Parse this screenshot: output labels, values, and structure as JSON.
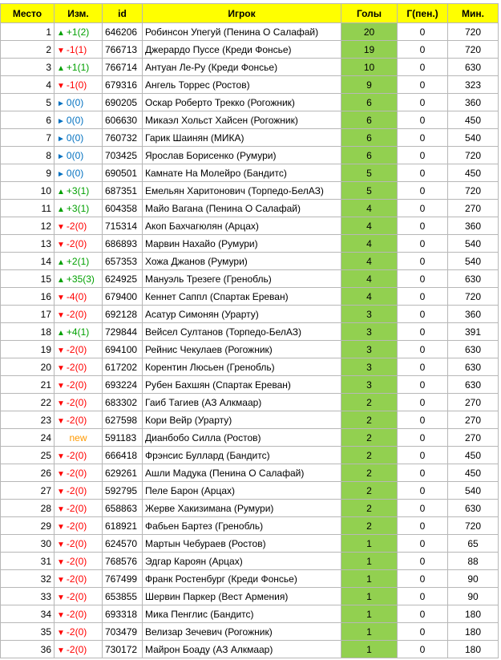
{
  "headers": [
    "Место",
    "Изм.",
    "id",
    "Игрок",
    "Голы",
    "Г(пен.)",
    "Мин."
  ],
  "colors": {
    "header_bg": "#ffff00",
    "goals_bg": "#92d050",
    "up": "#00a000",
    "down": "#ff0000",
    "same": "#0070c0",
    "new": "#ff9900"
  },
  "rows": [
    {
      "place": "1",
      "dir": "up",
      "change": "+1(2)",
      "id": "646206",
      "player": "Робинсон Упегуй (Пенина О Салафай)",
      "goals": "20",
      "pen": "0",
      "mins": "720"
    },
    {
      "place": "2",
      "dir": "down",
      "change": "-1(1)",
      "id": "766713",
      "player": "Джерардо Пуссе (Креди Фонсье)",
      "goals": "19",
      "pen": "0",
      "mins": "720"
    },
    {
      "place": "3",
      "dir": "up",
      "change": "+1(1)",
      "id": "766714",
      "player": "Антуан Ле-Ру (Креди Фонсье)",
      "goals": "10",
      "pen": "0",
      "mins": "630"
    },
    {
      "place": "4",
      "dir": "down",
      "change": "-1(0)",
      "id": "679316",
      "player": "Ангель Торрес (Ростов)",
      "goals": "9",
      "pen": "0",
      "mins": "323"
    },
    {
      "place": "5",
      "dir": "same",
      "change": "0(0)",
      "id": "690205",
      "player": "Оскар Роберто Трекко (Рогожник)",
      "goals": "6",
      "pen": "0",
      "mins": "360"
    },
    {
      "place": "6",
      "dir": "same",
      "change": "0(0)",
      "id": "606630",
      "player": "Микаэл Хольст Хайсен (Рогожник)",
      "goals": "6",
      "pen": "0",
      "mins": "450"
    },
    {
      "place": "7",
      "dir": "same",
      "change": "0(0)",
      "id": "760732",
      "player": "Гарик Шаинян (МИКА)",
      "goals": "6",
      "pen": "0",
      "mins": "540"
    },
    {
      "place": "8",
      "dir": "same",
      "change": "0(0)",
      "id": "703425",
      "player": "Ярослав Борисенко (Румури)",
      "goals": "6",
      "pen": "0",
      "mins": "720"
    },
    {
      "place": "9",
      "dir": "same",
      "change": "0(0)",
      "id": "690501",
      "player": "Камнате На Молейро (Бандитс)",
      "goals": "5",
      "pen": "0",
      "mins": "450"
    },
    {
      "place": "10",
      "dir": "up",
      "change": "+3(1)",
      "id": "687351",
      "player": "Емельян Харитонович (Торпедо-БелАЗ)",
      "goals": "5",
      "pen": "0",
      "mins": "720"
    },
    {
      "place": "11",
      "dir": "up",
      "change": "+3(1)",
      "id": "604358",
      "player": "Майо Вагана (Пенина О Салафай)",
      "goals": "4",
      "pen": "0",
      "mins": "270"
    },
    {
      "place": "12",
      "dir": "down",
      "change": "-2(0)",
      "id": "715314",
      "player": "Акоп Бахчагюлян (Арцах)",
      "goals": "4",
      "pen": "0",
      "mins": "360"
    },
    {
      "place": "13",
      "dir": "down",
      "change": "-2(0)",
      "id": "686893",
      "player": "Марвин Нахайо (Румури)",
      "goals": "4",
      "pen": "0",
      "mins": "540"
    },
    {
      "place": "14",
      "dir": "up",
      "change": "+2(1)",
      "id": "657353",
      "player": "Хожа Джанов (Румури)",
      "goals": "4",
      "pen": "0",
      "mins": "540"
    },
    {
      "place": "15",
      "dir": "up",
      "change": "+35(3)",
      "id": "624925",
      "player": "Мануэль Трезеге (Гренобль)",
      "goals": "4",
      "pen": "0",
      "mins": "630"
    },
    {
      "place": "16",
      "dir": "down",
      "change": "-4(0)",
      "id": "679400",
      "player": "Кеннет Саппл (Спартак Ереван)",
      "goals": "4",
      "pen": "0",
      "mins": "720"
    },
    {
      "place": "17",
      "dir": "down",
      "change": "-2(0)",
      "id": "692128",
      "player": "Асатур Симонян (Урарту)",
      "goals": "3",
      "pen": "0",
      "mins": "360"
    },
    {
      "place": "18",
      "dir": "up",
      "change": "+4(1)",
      "id": "729844",
      "player": "Вейсел Султанов (Торпедо-БелАЗ)",
      "goals": "3",
      "pen": "0",
      "mins": "391"
    },
    {
      "place": "19",
      "dir": "down",
      "change": "-2(0)",
      "id": "694100",
      "player": "Рейнис Чекулаев (Рогожник)",
      "goals": "3",
      "pen": "0",
      "mins": "630"
    },
    {
      "place": "20",
      "dir": "down",
      "change": "-2(0)",
      "id": "617202",
      "player": "Корентин Люсьен (Гренобль)",
      "goals": "3",
      "pen": "0",
      "mins": "630"
    },
    {
      "place": "21",
      "dir": "down",
      "change": "-2(0)",
      "id": "693224",
      "player": "Рубен Бахшян (Спартак Ереван)",
      "goals": "3",
      "pen": "0",
      "mins": "630"
    },
    {
      "place": "22",
      "dir": "down",
      "change": "-2(0)",
      "id": "683302",
      "player": "Гаиб Тагиев (АЗ Алкмаар)",
      "goals": "2",
      "pen": "0",
      "mins": "270"
    },
    {
      "place": "23",
      "dir": "down",
      "change": "-2(0)",
      "id": "627598",
      "player": "Кори Вейр (Урарту)",
      "goals": "2",
      "pen": "0",
      "mins": "270"
    },
    {
      "place": "24",
      "dir": "new",
      "change": "new",
      "id": "591183",
      "player": "Дианбобо Силла (Ростов)",
      "goals": "2",
      "pen": "0",
      "mins": "270"
    },
    {
      "place": "25",
      "dir": "down",
      "change": "-2(0)",
      "id": "666418",
      "player": "Фрэнсис Буллард (Бандитс)",
      "goals": "2",
      "pen": "0",
      "mins": "450"
    },
    {
      "place": "26",
      "dir": "down",
      "change": "-2(0)",
      "id": "629261",
      "player": "Ашли Мадука (Пенина О Салафай)",
      "goals": "2",
      "pen": "0",
      "mins": "450"
    },
    {
      "place": "27",
      "dir": "down",
      "change": "-2(0)",
      "id": "592795",
      "player": "Пеле Барон (Арцах)",
      "goals": "2",
      "pen": "0",
      "mins": "540"
    },
    {
      "place": "28",
      "dir": "down",
      "change": "-2(0)",
      "id": "658863",
      "player": "Жерве Хакизимана (Румури)",
      "goals": "2",
      "pen": "0",
      "mins": "630"
    },
    {
      "place": "29",
      "dir": "down",
      "change": "-2(0)",
      "id": "618921",
      "player": "Фабьен Бартез (Гренобль)",
      "goals": "2",
      "pen": "0",
      "mins": "720"
    },
    {
      "place": "30",
      "dir": "down",
      "change": "-2(0)",
      "id": "624570",
      "player": "Мартын Чебураев (Ростов)",
      "goals": "1",
      "pen": "0",
      "mins": "65"
    },
    {
      "place": "31",
      "dir": "down",
      "change": "-2(0)",
      "id": "768576",
      "player": "Эдгар Кароян (Арцах)",
      "goals": "1",
      "pen": "0",
      "mins": "88"
    },
    {
      "place": "32",
      "dir": "down",
      "change": "-2(0)",
      "id": "767499",
      "player": "Франк Ростенбург (Креди Фонсье)",
      "goals": "1",
      "pen": "0",
      "mins": "90"
    },
    {
      "place": "33",
      "dir": "down",
      "change": "-2(0)",
      "id": "653855",
      "player": "Шервин Паркер (Вест Армения)",
      "goals": "1",
      "pen": "0",
      "mins": "90"
    },
    {
      "place": "34",
      "dir": "down",
      "change": "-2(0)",
      "id": "693318",
      "player": "Мика Пенглис (Бандитс)",
      "goals": "1",
      "pen": "0",
      "mins": "180"
    },
    {
      "place": "35",
      "dir": "down",
      "change": "-2(0)",
      "id": "703479",
      "player": "Велизар Зечевич (Рогожник)",
      "goals": "1",
      "pen": "0",
      "mins": "180"
    },
    {
      "place": "36",
      "dir": "down",
      "change": "-2(0)",
      "id": "730172",
      "player": "Майрон Боаду (АЗ Алкмаар)",
      "goals": "1",
      "pen": "0",
      "mins": "180"
    }
  ]
}
